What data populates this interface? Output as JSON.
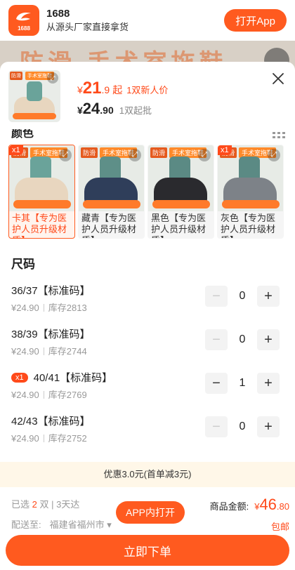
{
  "banner": {
    "logo_text": "1688",
    "app_name": "1688",
    "slogan": "从源头厂家直接拿货",
    "open_app": "打开App"
  },
  "background_title": "防滑 手术室拖鞋",
  "product": {
    "thumb_tag1": "防滑",
    "thumb_tag2": "手术室拖鞋",
    "promo_price_yen": "¥",
    "promo_price_int": "21",
    "promo_price_dec": ".9",
    "promo_price_suffix": "起",
    "promo_note": "1双新人价",
    "price_yen": "¥",
    "price_int": "24",
    "price_dec": ".90",
    "min_order": "1双起批"
  },
  "colors": {
    "title": "颜色",
    "items": [
      {
        "label": "卡其【专为医护人员升级材质】",
        "badge": "x1",
        "tag1": "防滑",
        "tag2": "手术室拖鞋",
        "shoe_color": "#e8d6bf",
        "leg_color": "#6aa39a",
        "selected": true
      },
      {
        "label": "藏青【专为医护人员升级材质】",
        "badge": "",
        "tag1": "防滑",
        "tag2": "手术室拖鞋",
        "shoe_color": "#2f3e5a",
        "leg_color": "#5e8f88",
        "selected": false
      },
      {
        "label": "黑色【专为医护人员升级材质】",
        "badge": "",
        "tag1": "防滑",
        "tag2": "手术室拖鞋",
        "shoe_color": "#2a2a2e",
        "leg_color": "#5b8a84",
        "selected": false
      },
      {
        "label": "灰色【专为医护人员升级材质】",
        "badge": "x1",
        "tag1": "防滑",
        "tag2": "手术室拖鞋",
        "shoe_color": "#7d8288",
        "leg_color": "#5b8a84",
        "selected": false
      }
    ]
  },
  "sizes": {
    "title": "尺码",
    "items": [
      {
        "name": "36/37【标准码】",
        "badge": "",
        "price": "¥24.90",
        "stock": "库存2813",
        "qty": "0"
      },
      {
        "name": "38/39【标准码】",
        "badge": "",
        "price": "¥24.90",
        "stock": "库存2744",
        "qty": "0"
      },
      {
        "name": "40/41【标准码】",
        "badge": "x1",
        "price": "¥24.90",
        "stock": "库存2769",
        "qty": "1"
      },
      {
        "name": "42/43【标准码】",
        "badge": "",
        "price": "¥24.90",
        "stock": "库存2752",
        "qty": "0"
      }
    ]
  },
  "discount": "优惠3.0元(首单减3元)",
  "footer": {
    "selected_prefix": "已选",
    "selected_count": "2",
    "selected_suffix": "双 | 3天达",
    "ship_to_label": "配送至:",
    "ship_to_value": "福建省福州市 ▾",
    "app_open": "APP内打开",
    "total_label": "商品金额:",
    "total_yen": "¥",
    "total_int": "46",
    "total_dec": ".80",
    "shipping": "包邮",
    "order_button": "立即下单"
  },
  "colors_theme": {
    "accent": "#ff5a1f",
    "price": "#ff4a1a"
  }
}
